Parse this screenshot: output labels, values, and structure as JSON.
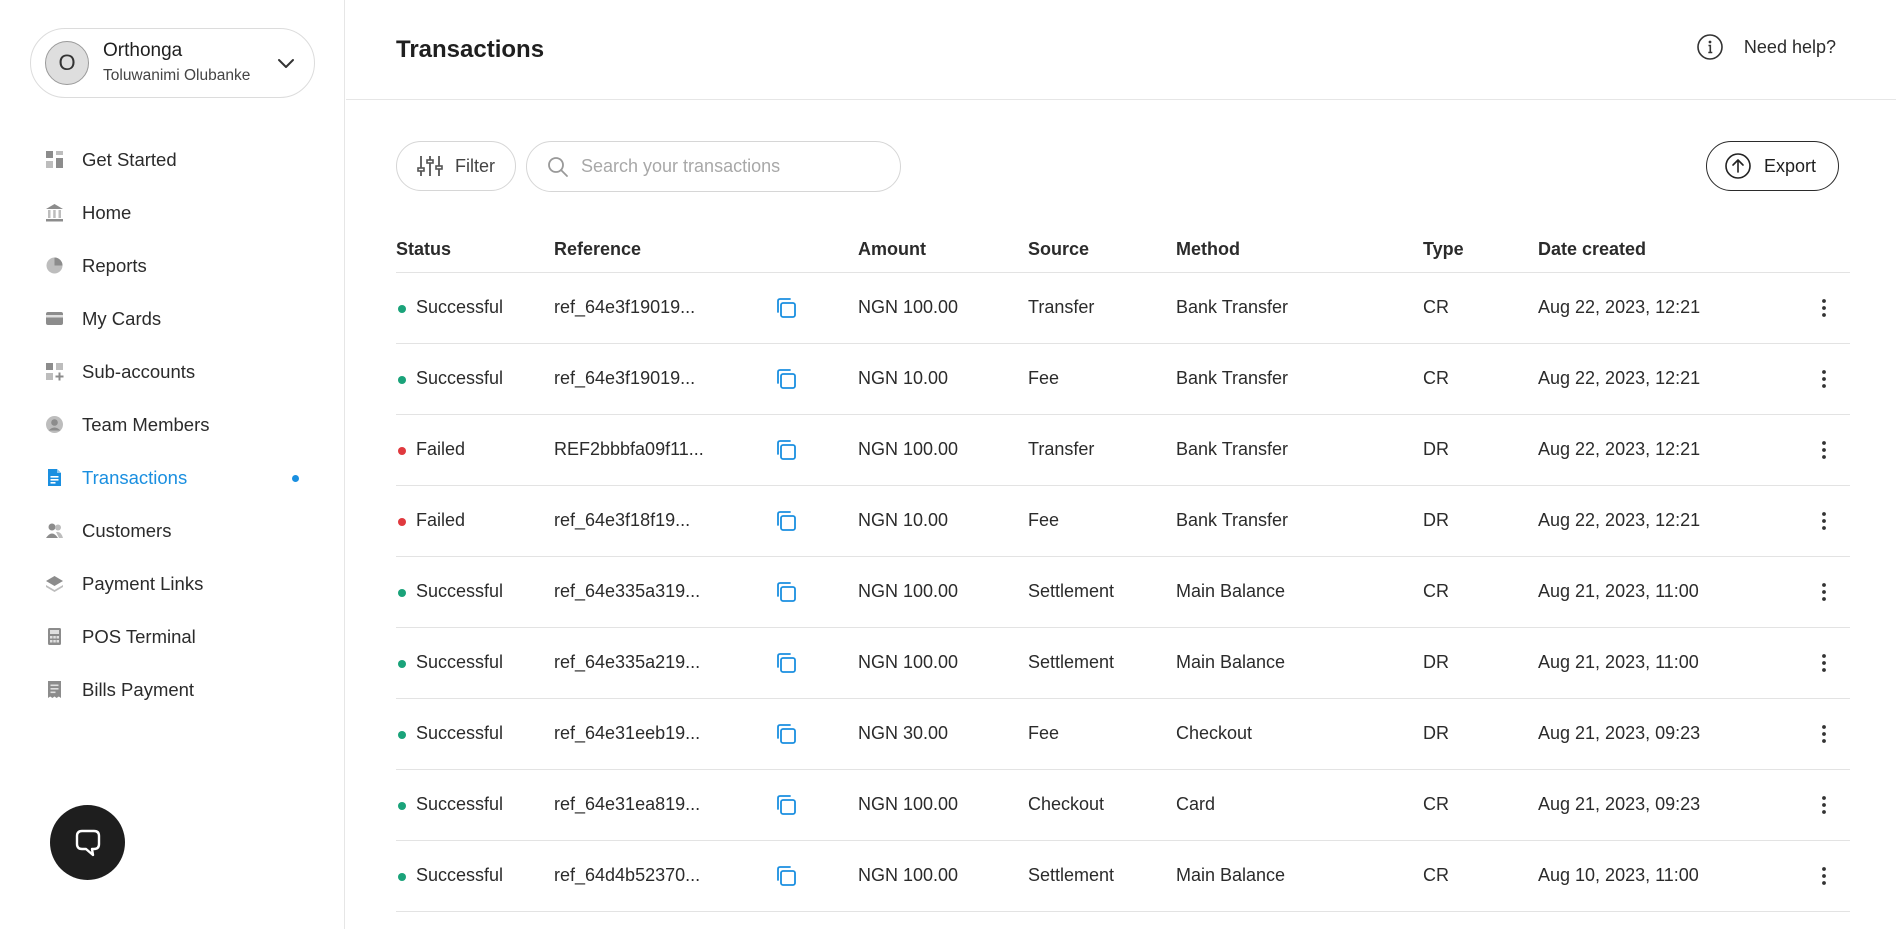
{
  "account": {
    "initial": "O",
    "business_name": "Orthonga",
    "user_name": "Toluwanimi Olubanke"
  },
  "sidebar": {
    "items": [
      {
        "label": "Get Started",
        "icon": "grid-icon",
        "active": false
      },
      {
        "label": "Home",
        "icon": "bank-icon",
        "active": false
      },
      {
        "label": "Reports",
        "icon": "pie-chart-icon",
        "active": false
      },
      {
        "label": "My Cards",
        "icon": "card-icon",
        "active": false
      },
      {
        "label": "Sub-accounts",
        "icon": "grid-plus-icon",
        "active": false
      },
      {
        "label": "Team Members",
        "icon": "user-circle-icon",
        "active": false
      },
      {
        "label": "Transactions",
        "icon": "document-icon",
        "active": true
      },
      {
        "label": "Customers",
        "icon": "users-icon",
        "active": false
      },
      {
        "label": "Payment Links",
        "icon": "layers-icon",
        "active": false
      },
      {
        "label": "POS Terminal",
        "icon": "calculator-icon",
        "active": false
      },
      {
        "label": "Bills Payment",
        "icon": "receipt-icon",
        "active": false
      }
    ]
  },
  "header": {
    "title": "Transactions",
    "help_label": "Need help?"
  },
  "toolbar": {
    "filter_label": "Filter",
    "search_placeholder": "Search your transactions",
    "export_label": "Export"
  },
  "table": {
    "columns": [
      "Status",
      "Reference",
      "Amount",
      "Source",
      "Method",
      "Type",
      "Date created"
    ],
    "rows": [
      {
        "status": "Successful",
        "reference": "ref_64e3f19019...",
        "amount": "NGN 100.00",
        "source": "Transfer",
        "method": "Bank Transfer",
        "type": "CR",
        "date": "Aug 22, 2023, 12:21"
      },
      {
        "status": "Successful",
        "reference": "ref_64e3f19019...",
        "amount": "NGN 10.00",
        "source": "Fee",
        "method": "Bank Transfer",
        "type": "CR",
        "date": "Aug 22, 2023, 12:21"
      },
      {
        "status": "Failed",
        "reference": "REF2bbbfa09f11...",
        "amount": "NGN 100.00",
        "source": "Transfer",
        "method": "Bank Transfer",
        "type": "DR",
        "date": "Aug 22, 2023, 12:21"
      },
      {
        "status": "Failed",
        "reference": "ref_64e3f18f19...",
        "amount": "NGN 10.00",
        "source": "Fee",
        "method": "Bank Transfer",
        "type": "DR",
        "date": "Aug 22, 2023, 12:21"
      },
      {
        "status": "Successful",
        "reference": "ref_64e335a319...",
        "amount": "NGN 100.00",
        "source": "Settlement",
        "method": "Main Balance",
        "type": "CR",
        "date": "Aug 21, 2023, 11:00"
      },
      {
        "status": "Successful",
        "reference": "ref_64e335a219...",
        "amount": "NGN 100.00",
        "source": "Settlement",
        "method": "Main Balance",
        "type": "DR",
        "date": "Aug 21, 2023, 11:00"
      },
      {
        "status": "Successful",
        "reference": "ref_64e31eeb19...",
        "amount": "NGN 30.00",
        "source": "Fee",
        "method": "Checkout",
        "type": "DR",
        "date": "Aug 21, 2023, 09:23"
      },
      {
        "status": "Successful",
        "reference": "ref_64e31ea819...",
        "amount": "NGN 100.00",
        "source": "Checkout",
        "method": "Card",
        "type": "CR",
        "date": "Aug 21, 2023, 09:23"
      },
      {
        "status": "Successful",
        "reference": "ref_64d4b52370...",
        "amount": "NGN 100.00",
        "source": "Settlement",
        "method": "Main Balance",
        "type": "CR",
        "date": "Aug 10, 2023, 11:00"
      }
    ]
  },
  "colors": {
    "accent": "#1a8fe0",
    "success": "#1aa37a",
    "failed": "#e0393e",
    "icon_gray": "#8c8c8c"
  }
}
